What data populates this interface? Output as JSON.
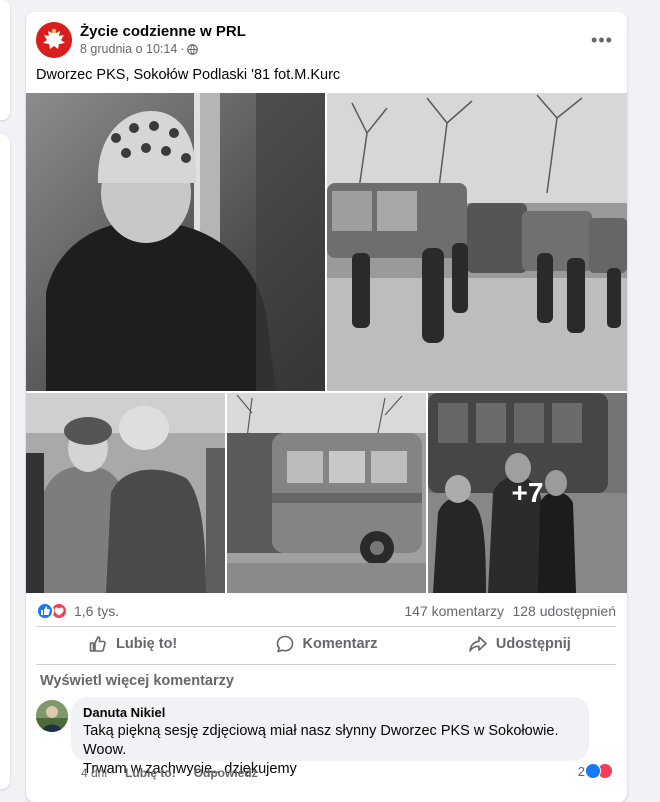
{
  "post": {
    "page_name": "Życie codzienne w PRL",
    "date": "8 grudnia o 10:14",
    "separator": "·",
    "caption": "Dworzec PKS, Sokołów Podlaski '81 fot.M.Kurc",
    "more_photos_label": "+7"
  },
  "stats": {
    "reactions": "1,6 tys.",
    "comments": "147 komentarzy",
    "shares": "128 udostępnień"
  },
  "actions": {
    "like": "Lubię to!",
    "comment": "Komentarz",
    "share": "Udostępnij"
  },
  "comments": {
    "view_more": "Wyświetl więcej komentarzy",
    "items": [
      {
        "author": "Danuta Nikiel",
        "text_line1": "Taką piękną sesję zdjęciową miał nasz słynny Dworzec PKS w Sokołowie. Woow.",
        "text_line2": "Trwam w zachwycie.. dziękujemy",
        "time": "4 dni",
        "like_label": "Lubię to!",
        "reply_label": "Odpowiedz",
        "reaction_count": "2"
      }
    ]
  },
  "colors": {
    "brand": "#1877f2",
    "love": "#f33e58",
    "muted_text": "#65676b"
  },
  "icons": [
    "globe-icon",
    "more-options-icon",
    "like-icon",
    "comment-icon",
    "share-icon",
    "eagle-logo-icon"
  ]
}
